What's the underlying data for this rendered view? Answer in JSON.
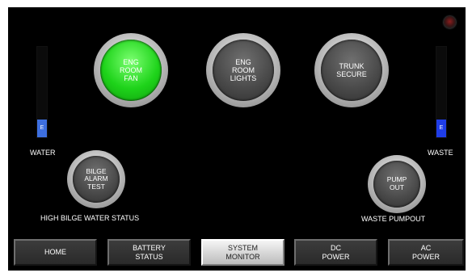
{
  "colors": {
    "panel_bg": "#000000",
    "active_green": "#1ed31a",
    "tank_fill": "#3d6fe0",
    "waste_fill": "#1f3de8"
  },
  "buttons": {
    "eng_room_fan": {
      "label": "ENG\nROOM\nFAN",
      "state": "on"
    },
    "eng_room_lights": {
      "label": "ENG\nROOM\nLIGHTS",
      "state": "off"
    },
    "trunk_secure": {
      "label": "TRUNK\nSECURE",
      "state": "off"
    },
    "bilge_alarm_test": {
      "label": "BILGE\nALARM\nTEST",
      "state": "off"
    },
    "pump_out": {
      "label": "PUMP\nOUT",
      "state": "off"
    }
  },
  "tanks": {
    "water": {
      "label": "WATER",
      "marker": "E",
      "level_fraction": 0.2
    },
    "waste": {
      "label": "WASTE",
      "marker": "E",
      "level_fraction": 0.2
    }
  },
  "status": {
    "high_bilge": "HIGH BILGE WATER STATUS",
    "waste_pumpout": "WASTE PUMPOUT"
  },
  "corner_indicator": {
    "icon": "red-indicator-light"
  },
  "nav": [
    {
      "label": "HOME",
      "active": false
    },
    {
      "label": "BATTERY\nSTATUS",
      "active": false
    },
    {
      "label": "SYSTEM\nMONITOR",
      "active": true
    },
    {
      "label": "DC\nPOWER",
      "active": false
    },
    {
      "label": "AC\nPOWER",
      "active": false
    }
  ]
}
